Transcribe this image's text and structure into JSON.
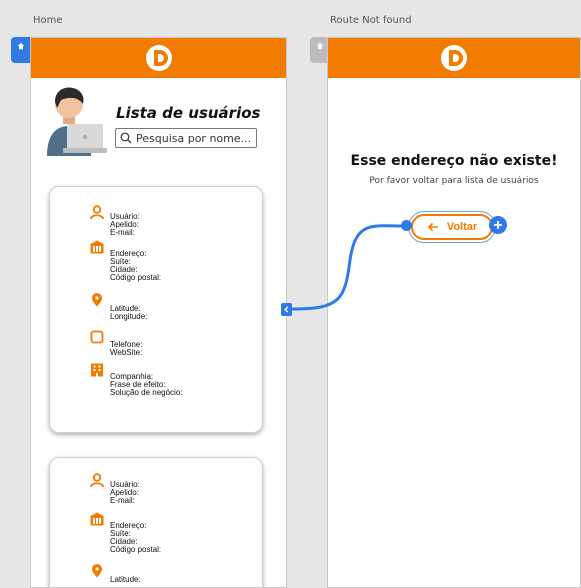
{
  "screens": {
    "home": {
      "title": "Home"
    },
    "not_found": {
      "title": "Route Not found"
    }
  },
  "home_list": {
    "title": "Lista de usuários",
    "search": {
      "placeholder": "Pesquisa por nome..."
    }
  },
  "user_card": {
    "personal": [
      "Usuário:",
      "Apelido:",
      "E-mail:"
    ],
    "address": [
      "Endereço:",
      "Suíte:",
      "Cidade:",
      "Código postal:"
    ],
    "location": [
      "Latitude:",
      "Longitude:"
    ],
    "contact": [
      "Telefone:",
      "WebSite:"
    ],
    "company": [
      "Companhia:",
      "Frase de efeito:",
      "Solução de negócio:"
    ]
  },
  "not_found_page": {
    "title": "Esse endereço não existe!",
    "subtitle": "Por favor voltar para lista de usuários",
    "back_label": "Voltar"
  },
  "colors": {
    "brand": "#f37c00",
    "accent": "#2f7ae5",
    "home_tag": "#2f7ae5",
    "inactive_tag": "#bcbcbc"
  },
  "icons": [
    "home-icon",
    "logo-icon",
    "search-icon",
    "person-icon",
    "building-icon",
    "location-pin-icon",
    "phone-icon",
    "company-icon",
    "arrow-left-icon",
    "plus-icon",
    "chevron-left-icon"
  ]
}
